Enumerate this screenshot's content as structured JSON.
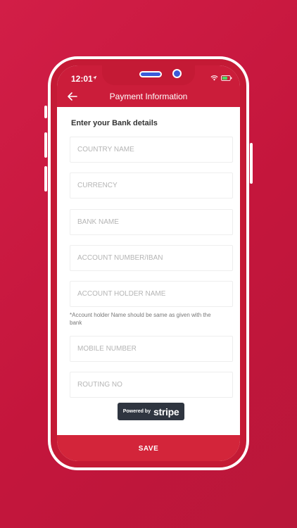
{
  "status_bar": {
    "time": "12:01"
  },
  "header": {
    "title": "Payment Information"
  },
  "form": {
    "heading": "Enter your Bank details",
    "fields": [
      {
        "placeholder": "COUNTRY NAME"
      },
      {
        "placeholder": "CURRENCY"
      },
      {
        "placeholder": "BANK NAME"
      },
      {
        "placeholder": "ACCOUNT NUMBER/IBAN"
      },
      {
        "placeholder": "ACCOUNT HOLDER NAME"
      },
      {
        "placeholder": "MOBILE NUMBER"
      },
      {
        "placeholder": "ROUTING NO"
      }
    ],
    "holder_note": "*Account holder Name should be same as given with the bank"
  },
  "stripe": {
    "prefix": "Powered by",
    "logo": "stripe"
  },
  "actions": {
    "save_label": "SAVE"
  },
  "icons": [
    "back-arrow-icon",
    "location-arrow-icon",
    "wifi-icon",
    "battery-icon"
  ],
  "colors": {
    "accent": "#cb1d3a",
    "background": "#c4163c",
    "badge": "#2f3540"
  }
}
